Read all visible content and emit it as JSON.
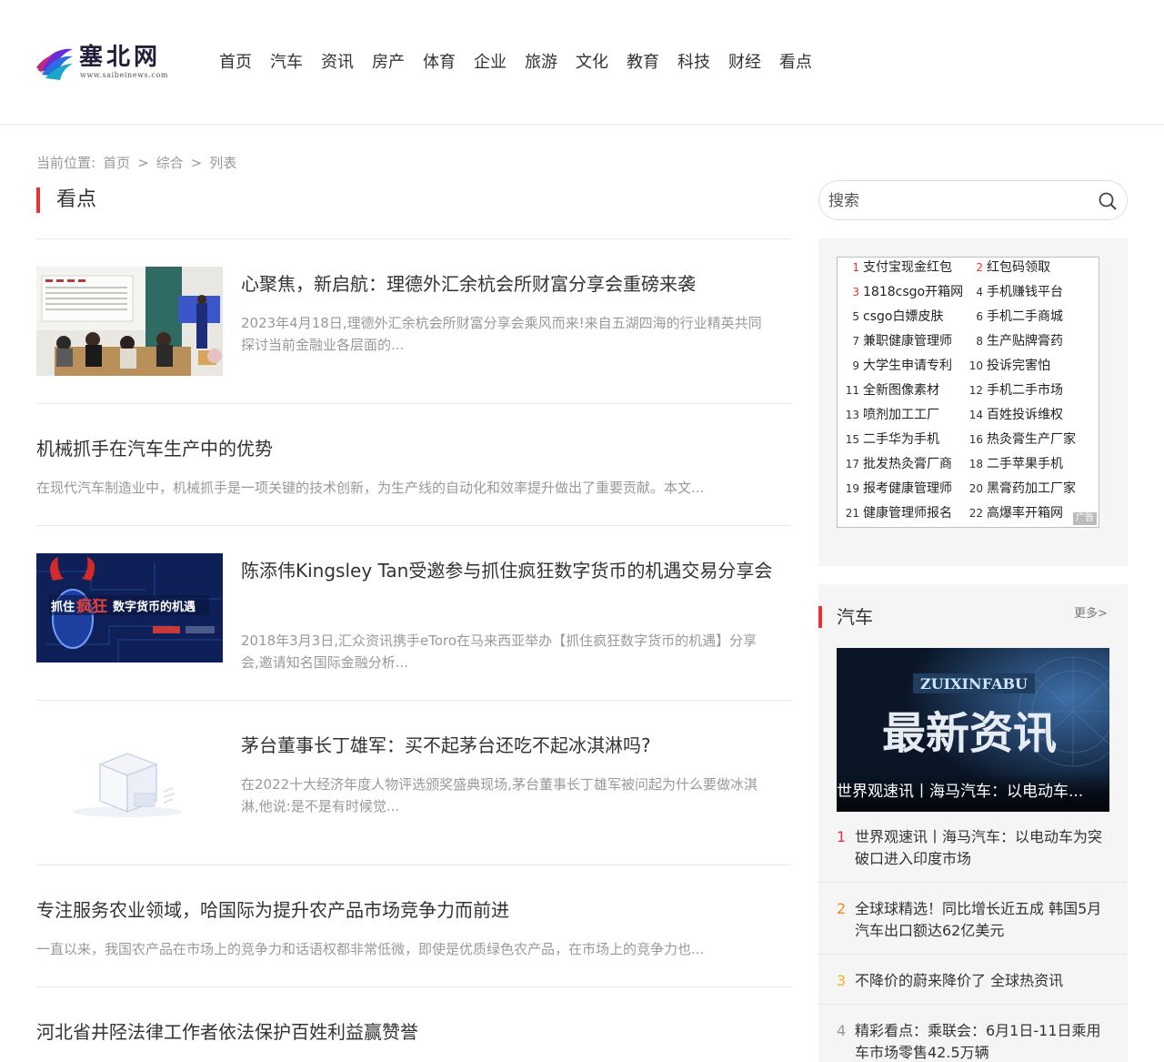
{
  "header": {
    "logo_name": "塞北网",
    "logo_url": "www.saibeinews.com",
    "nav": [
      "首页",
      "汽车",
      "资讯",
      "房产",
      "体育",
      "企业",
      "旅游",
      "文化",
      "教育",
      "科技",
      "财经",
      "看点"
    ]
  },
  "breadcrumb": {
    "label": "当前位置:",
    "items": [
      "首页",
      "综合",
      "列表"
    ],
    "sep": ">"
  },
  "section": {
    "title": "看点"
  },
  "articles": [
    {
      "title": "心聚焦，新启航：理德外汇余杭会所财富分享会重磅来袭",
      "summary": "2023年4月18日,理德外汇余杭会所财富分享会乘风而来!来自五湖四海的行业精英共同探讨当前金融业各层面的..."
    },
    {
      "title": "机械抓手在汽车生产中的优势",
      "summary": "在现代汽车制造业中，机械抓手是一项关键的技术创新，为生产线的自动化和效率提升做出了重要贡献。本文..."
    },
    {
      "title": "陈添伟Kingsley Tan受邀参与抓住疯狂数字货币的机遇交易分享会",
      "summary": "2018年3月3日,汇众资讯携手eToro在马来西亚举办【抓住疯狂数字货币的机遇】分享会,邀请知名国际金融分析...",
      "thumb_text": "抓住疯狂数字货币的机遇"
    },
    {
      "title": "茅台董事长丁雄军：买不起茅台还吃不起冰淇淋吗?",
      "summary": "在2022十大经济年度人物评选颁奖盛典现场,茅台董事长丁雄军被问起为什么要做冰淇淋,他说:是不是有时候觉..."
    },
    {
      "title": "专注服务农业领域，哈国际为提升农产品市场竞争力而前进",
      "summary": "一直以来，我国农产品在市场上的竞争力和话语权都非常低微，即使是优质绿色农产品，在市场上的竞争力也..."
    },
    {
      "title": "河北省井陉法律工作者依法保护百姓利益赢赞誉",
      "summary": ""
    }
  ],
  "search": {
    "placeholder": "搜索"
  },
  "ads": {
    "tag": "广告",
    "items": [
      {
        "n": "1",
        "t": "支付宝现金红包"
      },
      {
        "n": "2",
        "t": "红包码领取"
      },
      {
        "n": "3",
        "t": "1818csgo开箱网"
      },
      {
        "n": "4",
        "t": "手机赚钱平台"
      },
      {
        "n": "5",
        "t": "csgo白嫖皮肤"
      },
      {
        "n": "6",
        "t": "手机二手商城"
      },
      {
        "n": "7",
        "t": "兼职健康管理师"
      },
      {
        "n": "8",
        "t": "生产贴牌膏药"
      },
      {
        "n": "9",
        "t": "大学生申请专利"
      },
      {
        "n": "10",
        "t": "投诉完害怕"
      },
      {
        "n": "11",
        "t": "全新图像素材"
      },
      {
        "n": "12",
        "t": "手机二手市场"
      },
      {
        "n": "13",
        "t": "喷剂加工工厂"
      },
      {
        "n": "14",
        "t": "百姓投诉维权"
      },
      {
        "n": "15",
        "t": "二手华为手机"
      },
      {
        "n": "16",
        "t": "热灸膏生产厂家"
      },
      {
        "n": "17",
        "t": "批发热灸膏厂商"
      },
      {
        "n": "18",
        "t": "二手苹果手机"
      },
      {
        "n": "19",
        "t": "报考健康管理师"
      },
      {
        "n": "20",
        "t": "黑膏药加工厂家"
      },
      {
        "n": "21",
        "t": "健康管理师报名"
      },
      {
        "n": "22",
        "t": "高爆率开箱网"
      }
    ]
  },
  "car": {
    "title": "汽车",
    "more": "更多>",
    "hero_top": "ZUIXINFABU",
    "hero_big": "最新资讯",
    "hero_caption": "世界观速讯丨海马汽车：以电动车...",
    "items": [
      {
        "n": "1",
        "t": "世界观速讯丨海马汽车：以电动车为突破口进入印度市场",
        "color": "#e5343a"
      },
      {
        "n": "2",
        "t": "全球球精选！同比增长近五成 韩国5月汽车出口额达62亿美元",
        "color": "#f08a1c"
      },
      {
        "n": "3",
        "t": "不降价的蔚来降价了 全球热资讯",
        "color": "#f2b21c"
      },
      {
        "n": "4",
        "t": "精彩看点：乘联会：6月1日-11日乘用车市场零售42.5万辆",
        "color": "#999999"
      }
    ]
  }
}
